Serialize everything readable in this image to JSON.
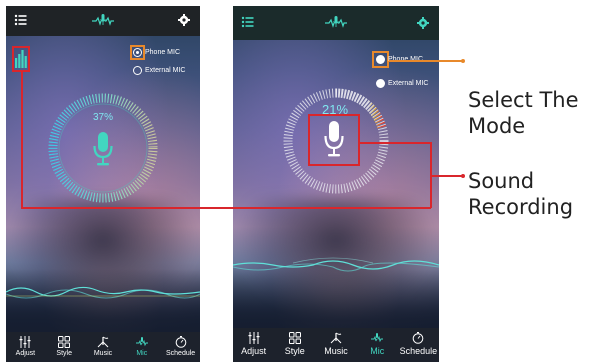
{
  "screens": [
    {
      "id": "left",
      "mode_options": [
        {
          "label": "Phone MIC",
          "checked": true
        },
        {
          "label": "External MIC",
          "checked": false
        }
      ],
      "level_percent": "37%",
      "nav": [
        {
          "label": "Adjust",
          "icon": "sliders-icon",
          "active": false
        },
        {
          "label": "Style",
          "icon": "grid-icon",
          "active": false
        },
        {
          "label": "Music",
          "icon": "note-icon",
          "active": false
        },
        {
          "label": "Mic",
          "icon": "mic-icon",
          "active": true
        },
        {
          "label": "Schedule",
          "icon": "clock-icon",
          "active": false
        }
      ]
    },
    {
      "id": "right",
      "mode_options": [
        {
          "label": "Phone MIC",
          "checked": true
        },
        {
          "label": "External MIC",
          "checked": false
        }
      ],
      "level_percent": "21%",
      "nav": [
        {
          "label": "Adjust",
          "icon": "sliders-icon",
          "active": false
        },
        {
          "label": "Style",
          "icon": "grid-icon",
          "active": false
        },
        {
          "label": "Music",
          "icon": "note-icon",
          "active": false
        },
        {
          "label": "Mic",
          "icon": "mic-icon",
          "active": true
        },
        {
          "label": "Schedule",
          "icon": "clock-icon",
          "active": false
        }
      ]
    }
  ],
  "callouts": {
    "mode": [
      "Select The",
      "Mode"
    ],
    "recording": [
      "Sound",
      "Recording"
    ]
  },
  "colors": {
    "accent": "#42d6c0",
    "highlight_orange": "#e8892b",
    "highlight_red": "#d9262c",
    "topbar": "#1f2326",
    "navbar": "#1d222c"
  }
}
